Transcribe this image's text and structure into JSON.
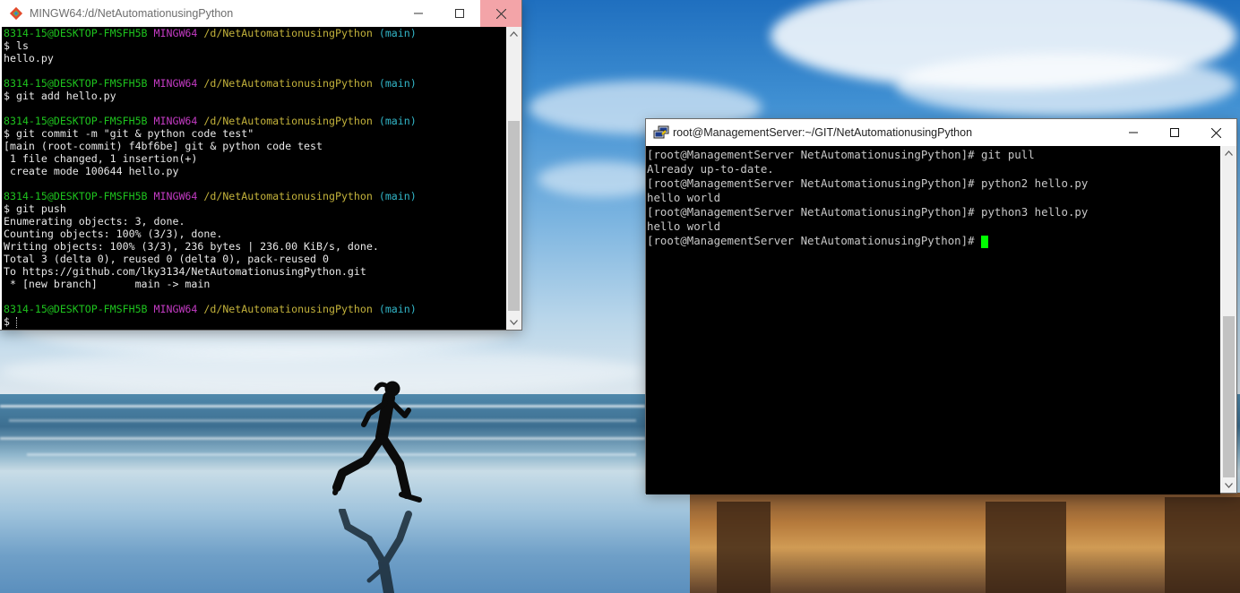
{
  "git_bash_window": {
    "title": "MINGW64:/d/NetAutomationusingPython",
    "icon": "git-diamond-icon",
    "accent_close": "#e81123",
    "prompt": {
      "user_host": "8314-15@DESKTOP-FMSFH5B",
      "env": "MINGW64",
      "path": "/d/NetAutomationusingPython",
      "branch": "(main)"
    },
    "lines": [
      {
        "type": "prompt"
      },
      {
        "type": "text",
        "text": "$ ls"
      },
      {
        "type": "text",
        "text": "hello.py"
      },
      {
        "type": "blank"
      },
      {
        "type": "prompt"
      },
      {
        "type": "text",
        "text": "$ git add hello.py"
      },
      {
        "type": "blank"
      },
      {
        "type": "prompt"
      },
      {
        "type": "text",
        "text": "$ git commit -m \"git & python code test\""
      },
      {
        "type": "text",
        "text": "[main (root-commit) f4bf6be] git & python code test"
      },
      {
        "type": "text",
        "text": " 1 file changed, 1 insertion(+)"
      },
      {
        "type": "text",
        "text": " create mode 100644 hello.py"
      },
      {
        "type": "blank"
      },
      {
        "type": "prompt"
      },
      {
        "type": "text",
        "text": "$ git push"
      },
      {
        "type": "text",
        "text": "Enumerating objects: 3, done."
      },
      {
        "type": "text",
        "text": "Counting objects: 100% (3/3), done."
      },
      {
        "type": "text",
        "text": "Writing objects: 100% (3/3), 236 bytes | 236.00 KiB/s, done."
      },
      {
        "type": "text",
        "text": "Total 3 (delta 0), reused 0 (delta 0), pack-reused 0"
      },
      {
        "type": "text",
        "text": "To https://github.com/lky3134/NetAutomationusingPython.git"
      },
      {
        "type": "text",
        "text": " * [new branch]      main -> main"
      },
      {
        "type": "blank"
      },
      {
        "type": "prompt"
      },
      {
        "type": "text",
        "text": "$ "
      }
    ]
  },
  "putty_window": {
    "title": "root@ManagementServer:~/GIT/NetAutomationusingPython",
    "icon": "putty-icon",
    "cursor_color": "#00ff00",
    "lines": [
      "[root@ManagementServer NetAutomationusingPython]# git pull",
      "Already up-to-date.",
      "[root@ManagementServer NetAutomationusingPython]# python2 hello.py",
      "hello world",
      "[root@ManagementServer NetAutomationusingPython]# python3 hello.py",
      "hello world",
      "[root@ManagementServer NetAutomationusingPython]# "
    ]
  },
  "colors": {
    "prompt_user": "#1ec41e",
    "prompt_env": "#c33bc3",
    "prompt_path": "#c3b23b",
    "prompt_branch": "#32b6c8",
    "terminal_bg": "#000000"
  }
}
